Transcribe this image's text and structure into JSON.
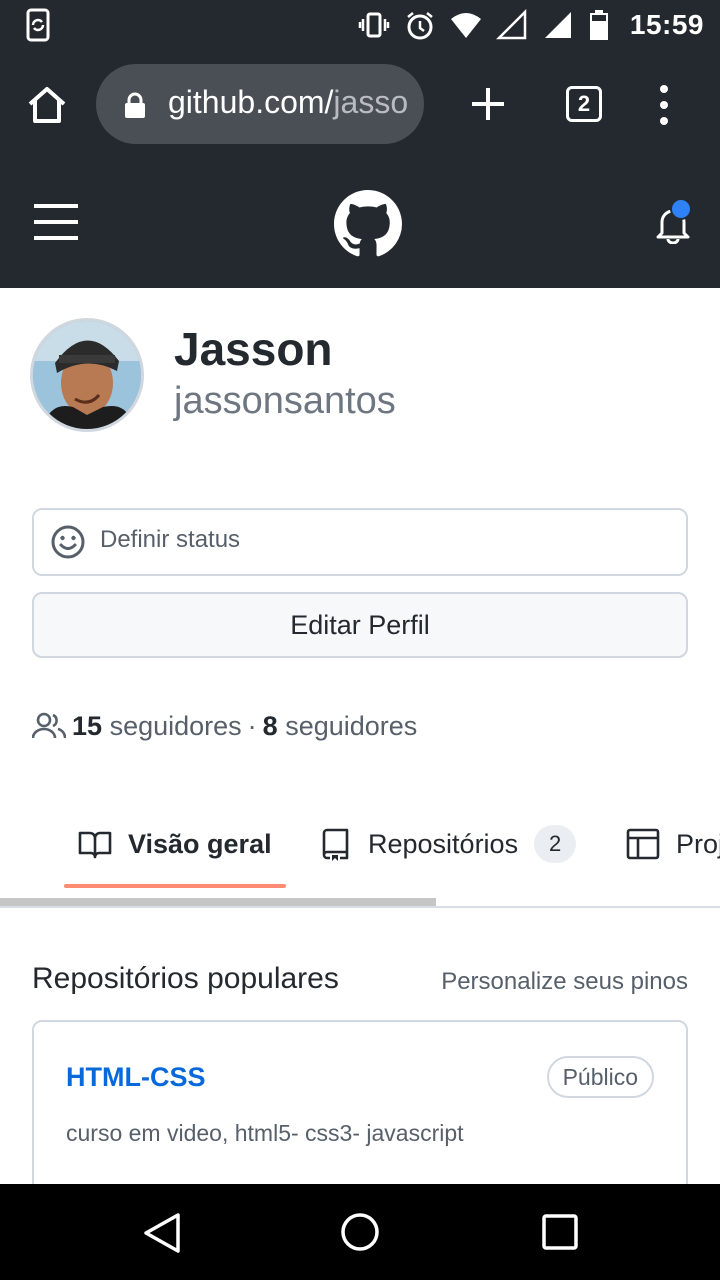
{
  "status_bar": {
    "time": "15:59",
    "icons": [
      "phone-sync-icon",
      "vibrate-icon",
      "alarm-icon",
      "wifi-icon",
      "signal-empty-icon",
      "signal-icon",
      "battery-icon"
    ]
  },
  "browser": {
    "url_host": "github.com/",
    "url_path": "jasso",
    "tab_count": "2"
  },
  "profile": {
    "name": "Jasson",
    "login": "jassonsantos",
    "status_placeholder": "Definir status",
    "edit_label": "Editar Perfil",
    "followers_count": "15",
    "followers_label": "seguidores",
    "following_count": "8",
    "following_label": "seguidores",
    "separator": "·"
  },
  "tabs": [
    {
      "label": "Visão geral",
      "icon": "book-icon",
      "selected": true
    },
    {
      "label": "Repositórios",
      "icon": "repo-icon",
      "counter": "2"
    },
    {
      "label": "Proj",
      "icon": "table-icon"
    }
  ],
  "popular": {
    "title": "Repositórios populares",
    "customize_label": "Personalize seus pinos",
    "repos": [
      {
        "name": "HTML-CSS",
        "visibility": "Público",
        "description": "curso em video, html5- css3- javascript"
      }
    ]
  },
  "colors": {
    "header_bg": "#24292f",
    "link": "#0969da",
    "tab_underline": "#fd8c73",
    "notification_dot": "#2f81f7"
  }
}
